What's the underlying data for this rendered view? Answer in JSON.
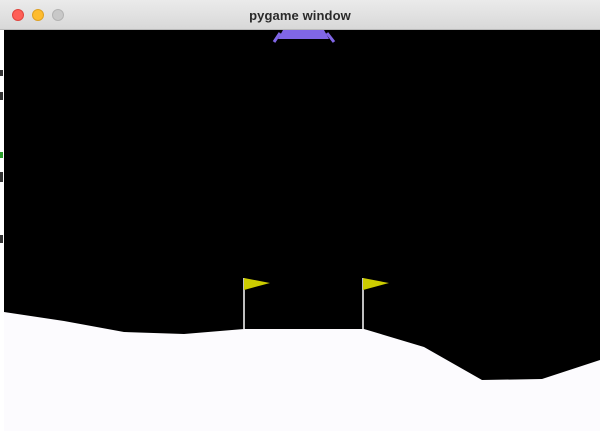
{
  "window": {
    "title": "pygame window",
    "controls": [
      "close",
      "minimize",
      "zoom"
    ]
  },
  "scene": {
    "sky_color": "#000000",
    "terrain_color": "#fcfbfe",
    "flag_color": "#cccc00",
    "flagpole_color": "#ffffff",
    "lander_color": "#8066e6",
    "icons": [
      "lander-icon",
      "landing-flag-icon"
    ]
  }
}
